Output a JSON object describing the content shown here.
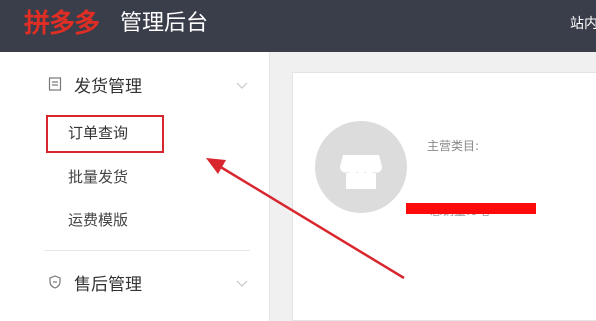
{
  "header": {
    "brand": "拼多多",
    "suffix": "管理后台",
    "top_link": "站内"
  },
  "sidebar": {
    "sections": [
      {
        "title": "发货管理",
        "icon": "document-icon",
        "items": [
          "订单查询",
          "批量发货",
          "运费模版"
        ]
      },
      {
        "title": "售后管理",
        "icon": "shield-icon"
      }
    ]
  },
  "main": {
    "category_label": "主营类目:",
    "redacted_text": "总销量:0笔"
  },
  "colors": {
    "header_bg": "#3a3d4a",
    "brand_red": "#e02e24",
    "highlight": "#d9262e",
    "annotation_arrow": "#d9262e"
  }
}
